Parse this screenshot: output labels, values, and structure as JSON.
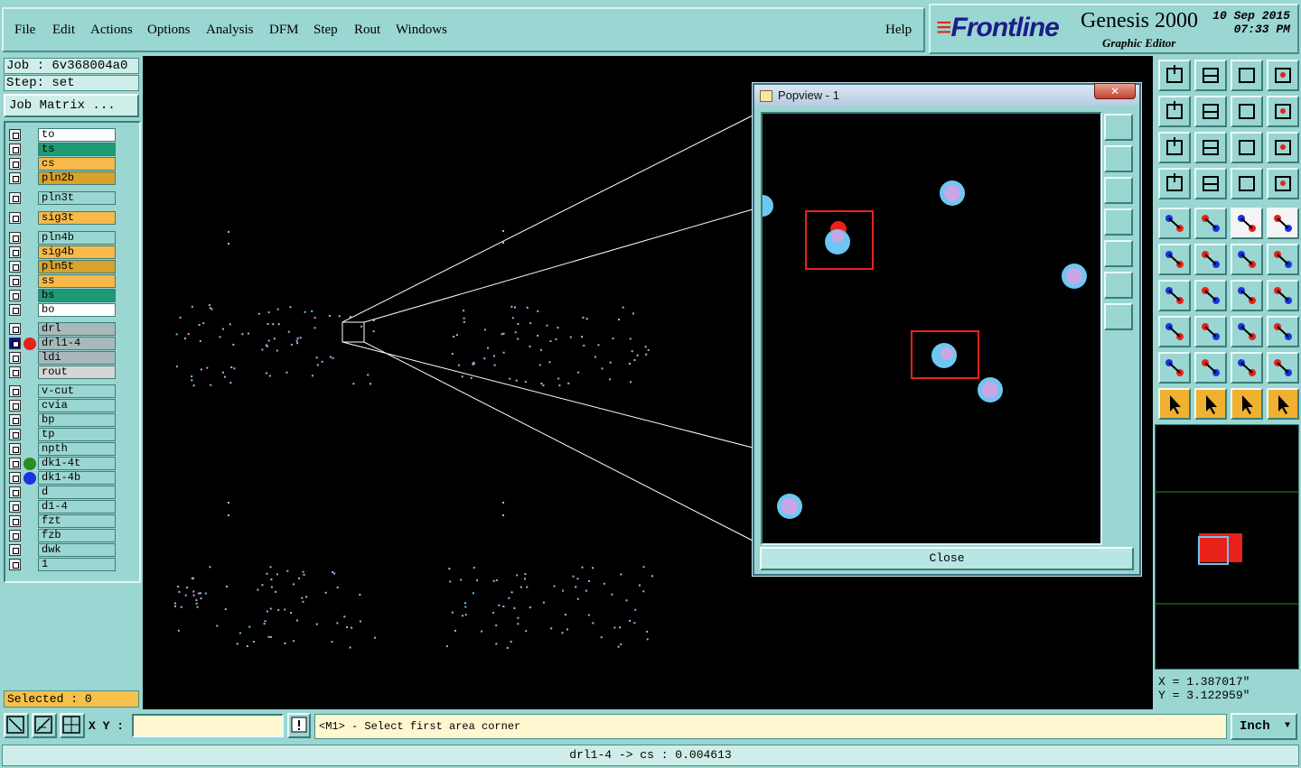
{
  "menu": {
    "items": [
      "File",
      "Edit",
      "Actions",
      "Options",
      "Analysis",
      "DFM",
      "Step",
      "Rout",
      "Windows"
    ],
    "help": "Help"
  },
  "brand": {
    "logo": "Frontline",
    "app": "Genesis 2000",
    "subtitle": "Graphic Editor",
    "date": "10 Sep 2015",
    "time": "07:33 PM"
  },
  "left_panel": {
    "job": "Job : 6v368004a0",
    "step": "Step: set",
    "job_matrix": "Job Matrix ...",
    "selected": "Selected : 0",
    "layers": [
      {
        "name": "to",
        "color": "#ffffff"
      },
      {
        "name": "ts",
        "color": "#1f9a75"
      },
      {
        "name": "cs",
        "color": "#f6b94a"
      },
      {
        "name": "pln2b",
        "color": "#d9a22a"
      },
      {
        "name": "pln3t",
        "color": "#9ad6d2"
      },
      {
        "name": "sig3t",
        "color": "#f6b94a"
      },
      {
        "name": "pln4b",
        "color": "#9ad6d2"
      },
      {
        "name": "sig4b",
        "color": "#f6b94a"
      },
      {
        "name": "pln5t",
        "color": "#d9a22a"
      },
      {
        "name": "ss",
        "color": "#f6b94a"
      },
      {
        "name": "bs",
        "color": "#1f9a75"
      },
      {
        "name": "bo",
        "color": "#ffffff"
      },
      {
        "name": "drl",
        "color": "#a8b9bb"
      },
      {
        "name": "drl1-4",
        "color": "#a8b9bb",
        "active": true,
        "dot": "#e8221a"
      },
      {
        "name": "ldi",
        "color": "#a8b9bb"
      },
      {
        "name": "rout",
        "color": "#d6d6d6"
      },
      {
        "name": "v-cut",
        "color": "#9ad6d2"
      },
      {
        "name": "cvia",
        "color": "#9ad6d2"
      },
      {
        "name": "bp",
        "color": "#9ad6d2"
      },
      {
        "name": "tp",
        "color": "#9ad6d2"
      },
      {
        "name": "npth",
        "color": "#9ad6d2"
      },
      {
        "name": "dk1-4t",
        "color": "#9ad6d2",
        "dot": "#2e8a22"
      },
      {
        "name": "dk1-4b",
        "color": "#9ad6d2",
        "dot": "#1a34e0"
      },
      {
        "name": "d",
        "color": "#9ad6d2"
      },
      {
        "name": "d1-4",
        "color": "#9ad6d2"
      },
      {
        "name": "fzt",
        "color": "#9ad6d2"
      },
      {
        "name": "fzb",
        "color": "#9ad6d2"
      },
      {
        "name": "dwk",
        "color": "#9ad6d2"
      },
      {
        "name": "1",
        "color": "#9ad6d2"
      }
    ]
  },
  "popview": {
    "title": "Popview - 1",
    "close_x": "✕",
    "close_label": "Close"
  },
  "coords": {
    "x": "X = 1.387017\"",
    "y": "Y = 3.122959\""
  },
  "bottom": {
    "xy_label": "X Y :",
    "xy_value": "",
    "prompt": "<M1> - Select first area corner",
    "unit": "Inch",
    "unit_arrow": "▼",
    "status": "drl1-4 -> cs : 0.004613"
  },
  "colors": {
    "panel": "#9ad6d2",
    "canvas": "#000000",
    "pad_outer": "#6ec6f2",
    "pad_inner": "#c9a6e6",
    "highlight": "#e8221a"
  },
  "icons": {
    "toolbar": [
      "home-up-icon",
      "home-down-icon",
      "house-icon",
      "window-split-icon",
      "zoom-in-left-icon",
      "zoom-out-right-icon",
      "swap-icon",
      "snake-icon",
      "fit-icon",
      "zoom-center-icon",
      "ratio-icon",
      "help-icon",
      "probe-icon",
      "net-icon",
      "layers-a-icon",
      "layers-b-icon",
      "pad-select-icon",
      "cross-select-icon",
      "ruler-icon",
      "octagon-icon",
      "nodes-icon",
      "cross-node-icon",
      "arrow-node-icon",
      "arrow-node-b-icon",
      "line-red-icon",
      "line-blue-icon",
      "rotate-icon",
      "mirror-icon",
      "move-pad-icon",
      "line-dash-icon",
      "dimension-icon",
      "shape-icon",
      "arc-a-icon",
      "arc-b-icon",
      "arc-c-icon",
      "arc-d-icon",
      "pointer-icon",
      "pointer-box-icon",
      "pointer-route-icon",
      "pointer-net-icon"
    ]
  }
}
